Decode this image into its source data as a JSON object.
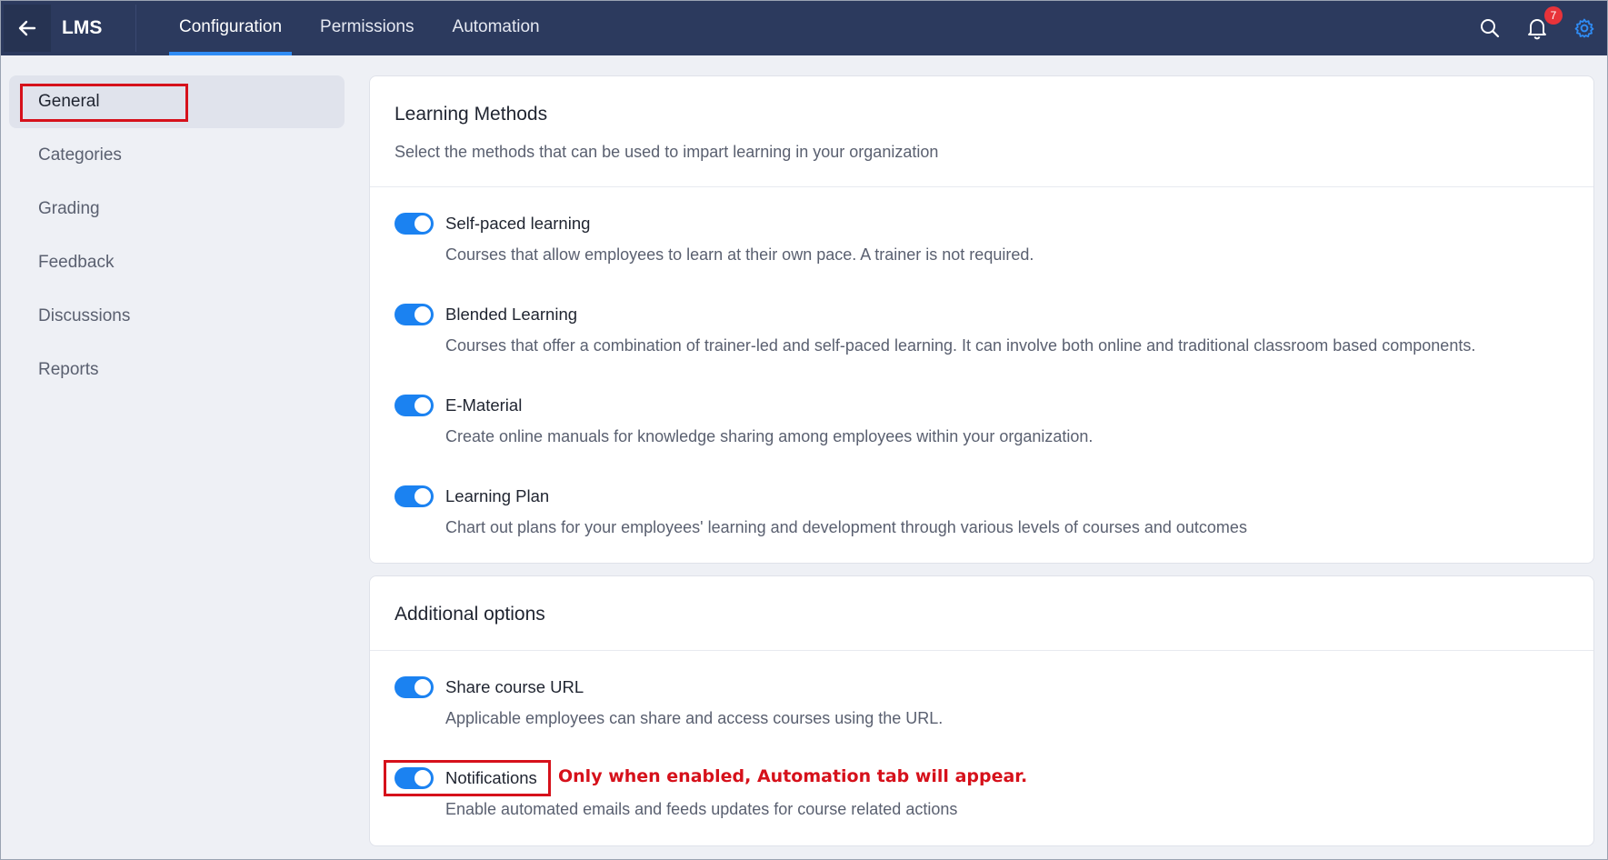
{
  "header": {
    "app_title": "LMS",
    "tabs": [
      {
        "label": "Configuration",
        "active": true
      },
      {
        "label": "Permissions",
        "active": false
      },
      {
        "label": "Automation",
        "active": false
      }
    ],
    "icons": [
      "back-arrow-icon",
      "search-icon",
      "bell-icon",
      "gear-icon"
    ],
    "notification_count": "7"
  },
  "sidebar": {
    "items": [
      {
        "label": "General",
        "active": true
      },
      {
        "label": "Categories"
      },
      {
        "label": "Grading"
      },
      {
        "label": "Feedback"
      },
      {
        "label": "Discussions"
      },
      {
        "label": "Reports"
      }
    ]
  },
  "learning_methods": {
    "title": "Learning Methods",
    "subtitle": "Select the methods that can be used to impart learning in your organization",
    "options": [
      {
        "label": "Self-paced learning",
        "description": "Courses that allow employees to learn at their own pace. A trainer is not required.",
        "enabled": true
      },
      {
        "label": "Blended Learning",
        "description": "Courses that offer a combination of trainer-led and self-paced learning. It can involve both online and traditional classroom based components.",
        "enabled": true
      },
      {
        "label": "E-Material",
        "description": "Create online manuals for knowledge sharing among employees within your organization.",
        "enabled": true
      },
      {
        "label": "Learning Plan",
        "description": "Chart out plans for your employees' learning and development through various levels of courses and outcomes",
        "enabled": true
      }
    ]
  },
  "additional_options": {
    "title": "Additional options",
    "options": [
      {
        "label": "Share course URL",
        "description": "Applicable employees can share and access courses using the URL.",
        "enabled": true
      },
      {
        "label": "Notifications",
        "description": "Enable automated emails and feeds updates for course related actions",
        "enabled": true
      }
    ]
  },
  "annotation": {
    "text": "Only when enabled, Automation tab will appear."
  },
  "colors": {
    "header_bg": "#2c3a5e",
    "accent": "#1b82f1",
    "highlight": "#d6111b",
    "badge": "#e8333a"
  }
}
